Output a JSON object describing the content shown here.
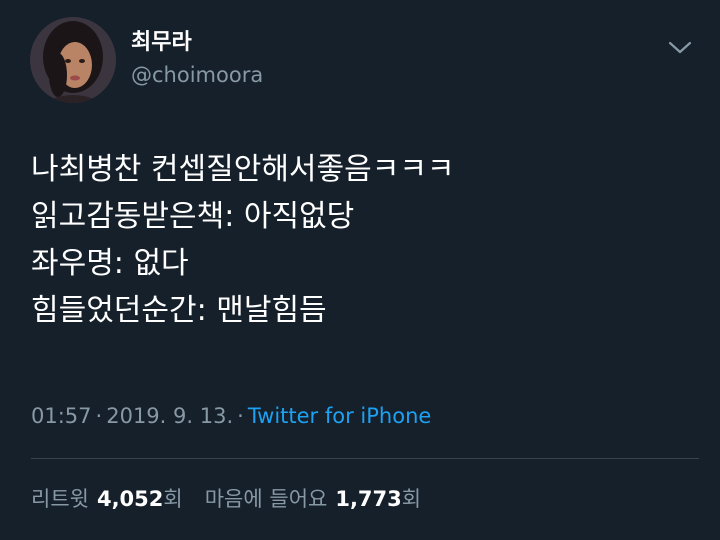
{
  "user": {
    "display_name": "최무라",
    "handle": "@choimoora"
  },
  "tweet": {
    "lines": [
      "나최병찬 컨셉질안해서좋음ㅋㅋㅋ",
      "읽고감동받은책: 아직없당",
      "좌우명: 없다",
      "힘들었던순간: 맨날힘듬"
    ]
  },
  "meta": {
    "time": "01:57",
    "separator": "·",
    "date": "2019. 9. 13.",
    "separator2": "·",
    "source": "Twitter for iPhone"
  },
  "stats": {
    "retweets_label": "리트윗",
    "retweets_count": "4,052",
    "retweets_unit": "회",
    "likes_label": "마음에 들어요",
    "likes_count": "1,773",
    "likes_unit": "회"
  },
  "colors": {
    "background": "#15202b",
    "text": "#ffffff",
    "secondary_text": "#8899a6",
    "link": "#1da1f2",
    "divider": "#38444d"
  },
  "icons": {
    "menu": "chevron-down-icon"
  }
}
